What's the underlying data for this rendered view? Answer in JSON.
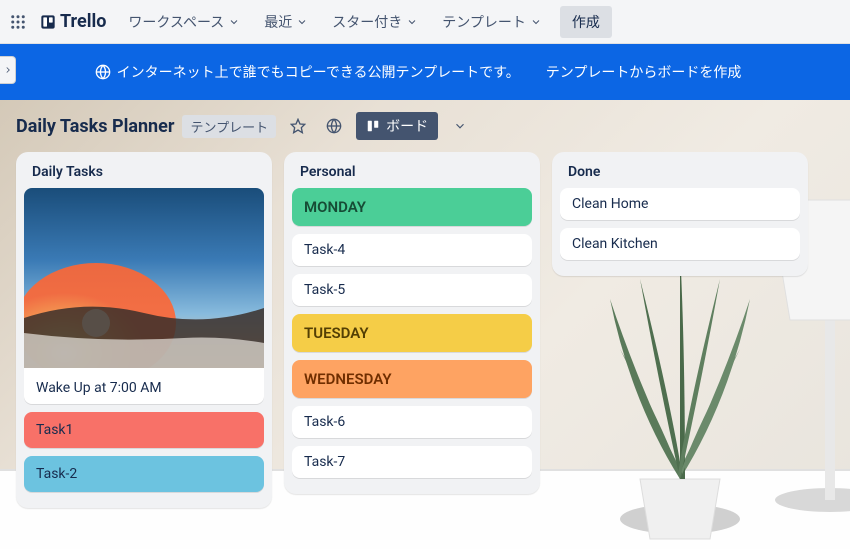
{
  "topbar": {
    "brand": "Trello",
    "nav": [
      {
        "label": "ワークスペース"
      },
      {
        "label": "最近"
      },
      {
        "label": "スター付き"
      },
      {
        "label": "テンプレート"
      }
    ],
    "create": "作成"
  },
  "banner": {
    "message": "インターネット上で誰でもコピーできる公開テンプレートです。",
    "cta": "テンプレートからボードを作成"
  },
  "board": {
    "title": "Daily Tasks Planner",
    "badge": "テンプレート",
    "view": "ボード"
  },
  "lists": [
    {
      "title": "Daily Tasks",
      "cards": [
        {
          "text": "Wake Up at 7:00 AM",
          "cover": "sunrise"
        },
        {
          "text": "Task1",
          "color": "task1"
        },
        {
          "text": "Task-2",
          "color": "task2"
        }
      ]
    },
    {
      "title": "Personal",
      "cards": [
        {
          "text": "MONDAY",
          "color": "monday"
        },
        {
          "text": "Task-4"
        },
        {
          "text": "Task-5"
        },
        {
          "text": "TUESDAY",
          "color": "tuesday"
        },
        {
          "text": "WEDNESDAY",
          "color": "wednesday"
        },
        {
          "text": "Task-6"
        },
        {
          "text": "Task-7"
        }
      ]
    },
    {
      "title": "Done",
      "cards": [
        {
          "text": "Clean Home"
        },
        {
          "text": "Clean Kitchen"
        }
      ]
    }
  ]
}
